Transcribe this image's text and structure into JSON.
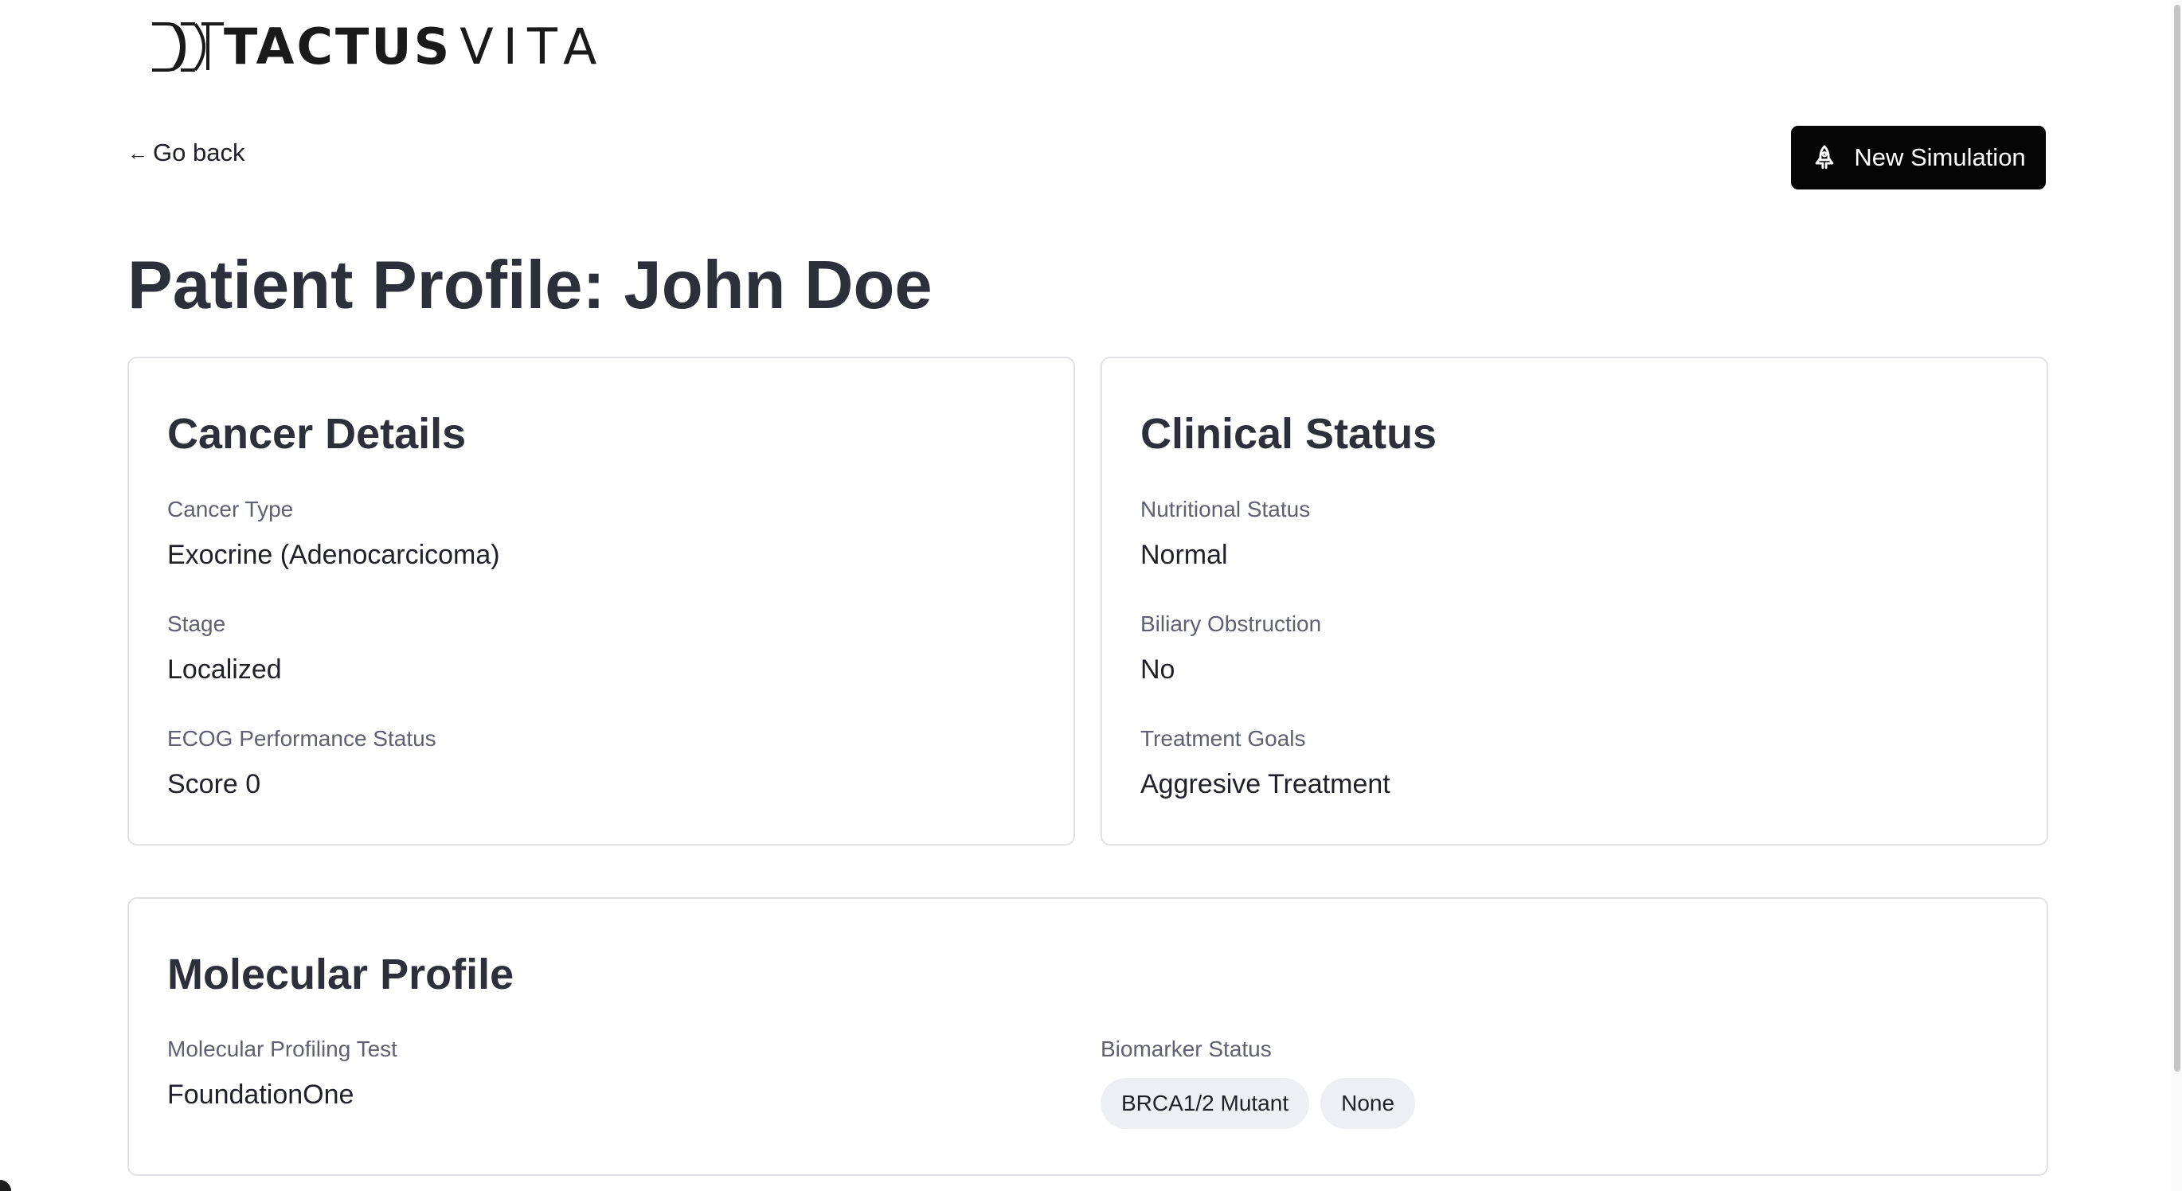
{
  "brand": {
    "name_bold": "TACTUS",
    "name_light": "VITA",
    "colors": {
      "text": "#1a1a1a"
    }
  },
  "nav": {
    "back_label": "Go back",
    "back_icon": "arrow-left-icon"
  },
  "actions": {
    "new_simulation_label": "New Simulation",
    "new_simulation_icon": "rocket-icon",
    "button_color": "#050505"
  },
  "page": {
    "title": "Patient Profile: John Doe"
  },
  "cancer_details": {
    "title": "Cancer Details",
    "fields": [
      {
        "label": "Cancer Type",
        "value": "Exocrine (Adenocarcicoma)"
      },
      {
        "label": "Stage",
        "value": "Localized"
      },
      {
        "label": "ECOG Performance Status",
        "value": "Score 0"
      }
    ]
  },
  "clinical_status": {
    "title": "Clinical Status",
    "fields": [
      {
        "label": "Nutritional Status",
        "value": "Normal"
      },
      {
        "label": "Biliary Obstruction",
        "value": "No"
      },
      {
        "label": "Treatment Goals",
        "value": "Aggresive Treatment"
      }
    ]
  },
  "molecular_profile": {
    "title": "Molecular Profile",
    "test": {
      "label": "Molecular Profiling Test",
      "value": "FoundationOne"
    },
    "biomarkers": {
      "label": "Biomarker Status",
      "values": [
        "BRCA1/2 Mutant",
        "None"
      ]
    }
  }
}
